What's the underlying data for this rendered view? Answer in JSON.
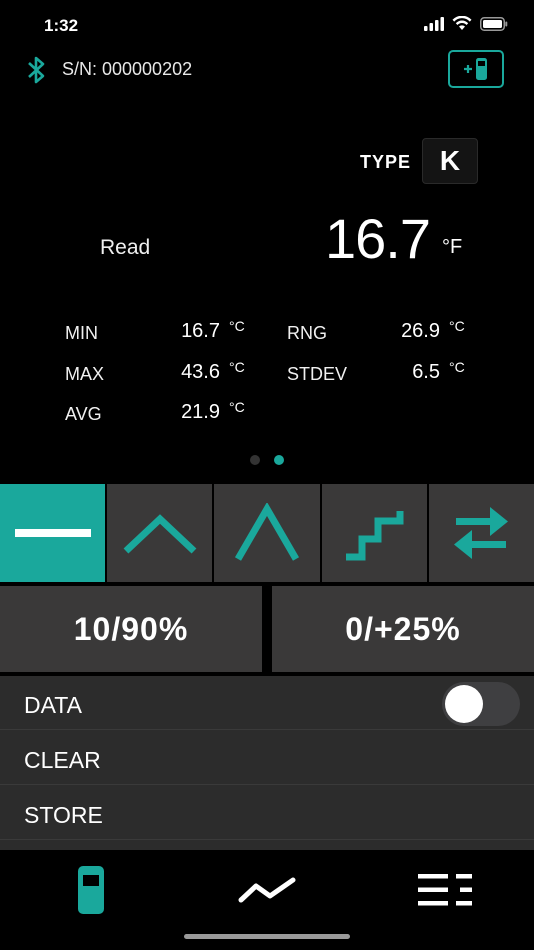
{
  "status_bar": {
    "time": "1:32"
  },
  "device": {
    "serial": "S/N: 000000202"
  },
  "thermocouple": {
    "type_label": "TYPE",
    "type_value": "K"
  },
  "reading": {
    "mode_label": "Read",
    "value": "16.7",
    "unit": "°F"
  },
  "stats": {
    "min_label": "MIN",
    "min_value": "16.7",
    "min_unit": "°C",
    "max_label": "MAX",
    "max_value": "43.6",
    "max_unit": "°C",
    "avg_label": "AVG",
    "avg_value": "21.9",
    "avg_unit": "°C",
    "rng_label": "RNG",
    "rng_value": "26.9",
    "rng_unit": "°C",
    "stdev_label": "STDEV",
    "stdev_value": "6.5",
    "stdev_unit": "°C"
  },
  "pager": {
    "count": 2,
    "active_index": 1
  },
  "waveforms": [
    "constant",
    "triangle",
    "sawtooth",
    "step",
    "swap"
  ],
  "percent_buttons": {
    "left": "10/90%",
    "right": "0/+25%"
  },
  "list": {
    "data_label": "DATA",
    "data_toggle": false,
    "clear_label": "CLEAR",
    "store_label": "STORE"
  },
  "colors": {
    "accent": "#1aa89c",
    "panel": "#3a3939",
    "list_bg": "#2c2c2c"
  },
  "tabs": [
    "device-icon",
    "trend-icon",
    "menu-list-icon"
  ]
}
